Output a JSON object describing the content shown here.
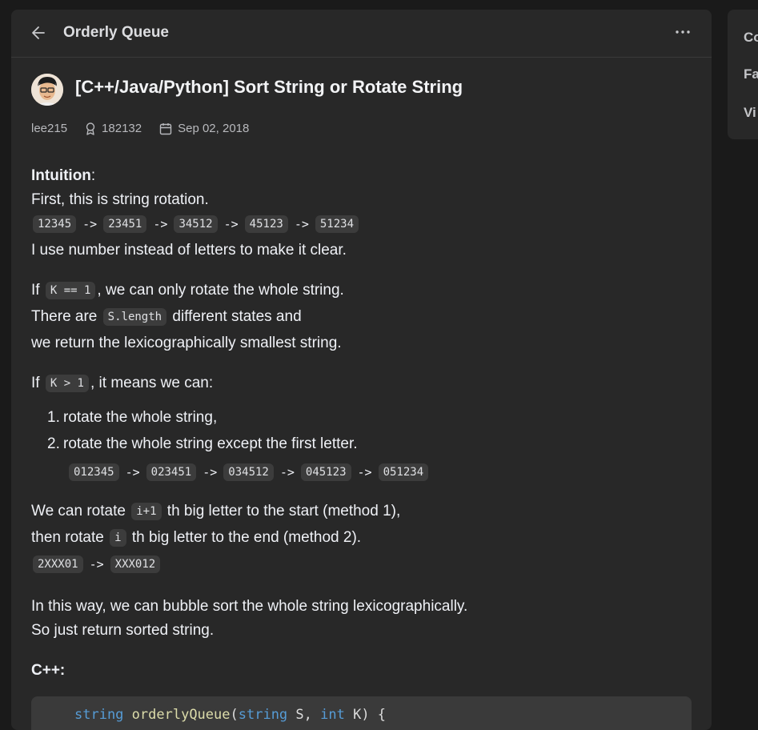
{
  "header": {
    "title": "Orderly Queue"
  },
  "post": {
    "title": "[C++/Java/Python] Sort String or Rotate String",
    "author": "lee215",
    "reputation": "182132",
    "date": "Sep 02, 2018"
  },
  "body": {
    "intuition_label": "Intuition",
    "colon": ":",
    "l1": "First, this is string rotation.",
    "rot": [
      "12345",
      "23451",
      "34512",
      "45123",
      "51234"
    ],
    "arrow": "->",
    "l2": "I use number instead of letters to make it clear.",
    "p2_a": "If ",
    "k_eq_1": "K == 1",
    "p2_b": ", we can only rotate the whole string.",
    "p2_c": "There are ",
    "s_length": "S.length",
    "p2_d": " different states and",
    "p2_e": "we return the lexicographically smallest string.",
    "p3_a": "If ",
    "k_gt_1": "K > 1",
    "p3_b": ", it means we can:",
    "li1_num": "1.",
    "li1": "rotate the whole string,",
    "li2_num": "2.",
    "li2": "rotate the whole string except the first letter.",
    "rot2": [
      "012345",
      "023451",
      "034512",
      "045123",
      "051234"
    ],
    "p4_a": "We can rotate ",
    "i_plus_1": "i+1",
    "p4_b": " th big letter to the start (method 1),",
    "p4_c": "then rotate ",
    "i": "i",
    "p4_d": " th big letter to the end (method 2).",
    "ex_from": "2XXX01",
    "ex_to": "XXX012",
    "p5_a": "In this way, we can bubble sort the whole string lexicographically.",
    "p5_b": "So just return sorted string.",
    "cpp_label": "C++:"
  },
  "code": {
    "type_kw": "string",
    "fn_name": "orderlyQueue",
    "paren_open": "(",
    "param_type": "string",
    "param1": " S, ",
    "int_kw": "int",
    "param2": " K) {"
  },
  "sidebar": {
    "items": [
      "Co",
      "Fa",
      "Vi"
    ]
  }
}
